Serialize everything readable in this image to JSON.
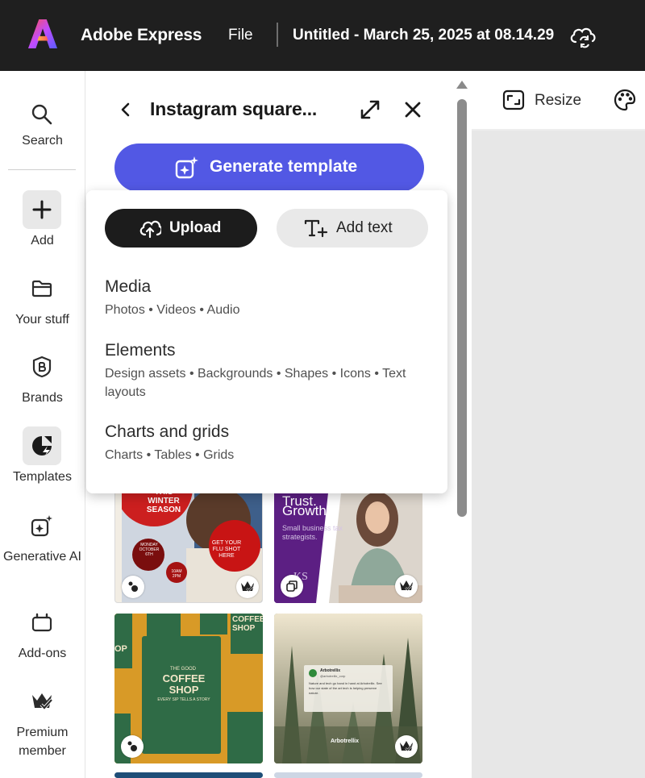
{
  "topbar": {
    "app_name": "Adobe Express",
    "file_menu": "File",
    "doc_title": "Untitled - March 25, 2025 at 08.14.29",
    "cloud_icon": "cloud-sync-icon"
  },
  "rail": {
    "items": [
      {
        "label": "Search",
        "icon": "search-icon"
      },
      {
        "label": "Add",
        "icon": "plus-icon"
      },
      {
        "label": "Your stuff",
        "icon": "folder-icon"
      },
      {
        "label": "Brands",
        "icon": "brand-icon"
      },
      {
        "label": "Templates",
        "icon": "templates-icon"
      },
      {
        "label": "Generative AI",
        "icon": "sparkle-icon"
      },
      {
        "label": "Add-ons",
        "icon": "addons-icon"
      },
      {
        "label": "Premium member",
        "icon": "crown-icon"
      }
    ]
  },
  "panel": {
    "title": "Instagram square...",
    "generate_label": "Generate template"
  },
  "popover": {
    "upload_label": "Upload",
    "add_text_label": "Add text",
    "menu": [
      {
        "title": "Media",
        "subtitle": "Photos • Videos • Audio"
      },
      {
        "title": "Elements",
        "subtitle": "Design assets • Backgrounds • Shapes • Icons • Text layouts"
      },
      {
        "title": "Charts and grids",
        "subtitle": "Charts • Tables • Grids"
      }
    ]
  },
  "templates": {
    "tile1": {
      "heading": "THIS WINTER SEASON",
      "date": "MONDAY OCTOBER 6TH",
      "cta": "GET YOUR FLU SHOT HERE",
      "time": "10AM 2PM"
    },
    "tile2": {
      "heading1": "Trust.",
      "heading2": "Growth.",
      "sub": "Small business tax strategists.",
      "logo": "KS"
    },
    "tile3": {
      "brand": "COFFEE SHOP",
      "tag": "EVERY SIP TELLS A STORY",
      "top": "THE GOOD",
      "side": "COFFEE SHOP",
      "left": "OP"
    },
    "tile4": {
      "card_title": "Arbotrellix",
      "card_sub": "@arbotrellix_corp",
      "card_body": "Nature and tech go hand in hand at Arbotrellix. See how our state of the art tech is helping preserve nature.",
      "footer": "Arbotrellix"
    }
  },
  "toolbar": {
    "resize_label": "Resize",
    "palette_icon": "palette-icon"
  },
  "colors": {
    "topbar_bg": "#1f1f1f",
    "accent_button": "#5258e4",
    "upload_button": "#1c1c1c",
    "canvas_bg": "#e7e7e7"
  }
}
